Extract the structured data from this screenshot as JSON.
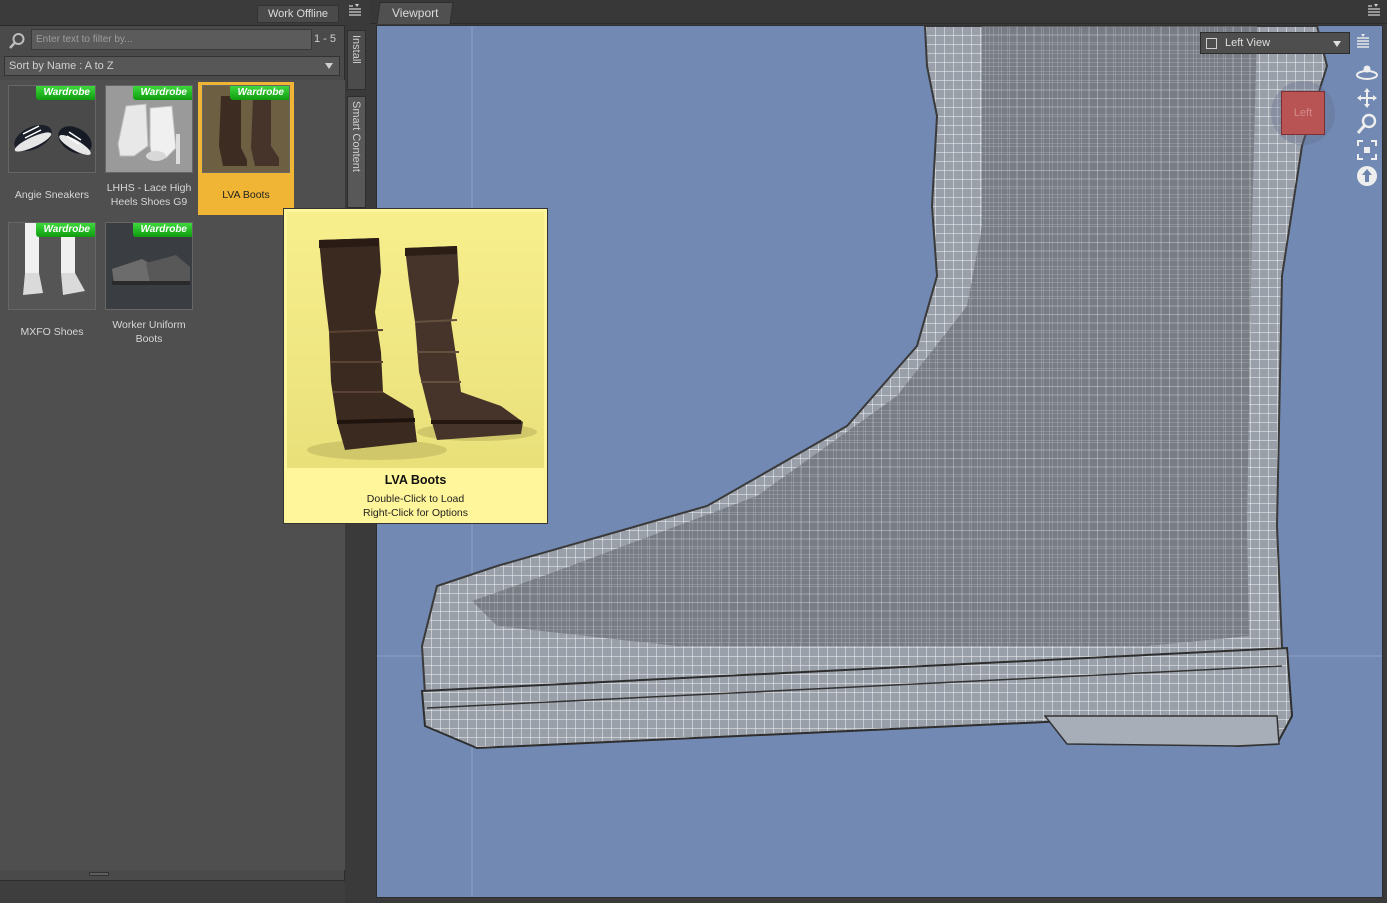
{
  "content_library": {
    "work_offline_label": "Work Offline",
    "filter_placeholder": "Enter text to filter by...",
    "result_count": "1 - 5",
    "sort_label": "Sort by Name : A to Z",
    "badge_label": "Wardrobe",
    "items": [
      {
        "label": "Angie Sneakers",
        "selected": false
      },
      {
        "label": "LHHS - Lace High Heels Shoes G9",
        "selected": false
      },
      {
        "label": "LVA Boots",
        "selected": true
      },
      {
        "label": "MXFO Shoes",
        "selected": false
      },
      {
        "label": "Worker Uniform Boots",
        "selected": false
      }
    ]
  },
  "side_tabs": {
    "install": "Install",
    "smart_content": "Smart Content"
  },
  "viewport": {
    "tab_label": "Viewport",
    "view_select": "Left View",
    "view_cube_label": "Left",
    "nav_icons": [
      "orbit-icon",
      "pan-icon",
      "zoom-icon",
      "frame-icon",
      "reset-view-icon"
    ]
  },
  "tooltip": {
    "title": "LVA Boots",
    "line1": "Double-Click to Load",
    "line2": "Right-Click for Options"
  },
  "colors": {
    "selection": "#f0b535",
    "badge_green": "#1fb81f",
    "viewport_bg": "#7189b3",
    "tooltip_bg": "#fff59a"
  }
}
